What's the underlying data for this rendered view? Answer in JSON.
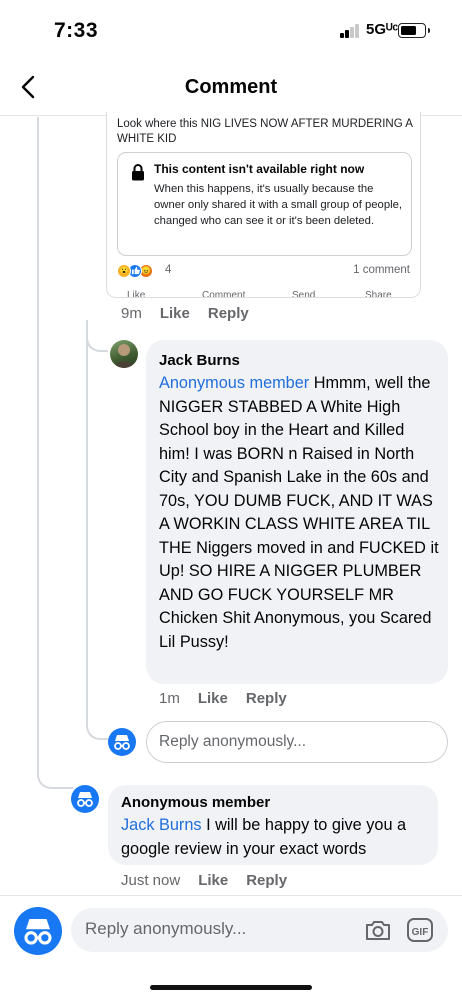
{
  "status_bar": {
    "time": "7:33",
    "network": "5Gᵁᶜ"
  },
  "header": {
    "title": "Comment",
    "back_icon": "chevron-left-icon"
  },
  "shared_post": {
    "text": "Look where this NIG LIVES NOW AFTER MURDERING A WHITE KID",
    "unavailable_title": "This content isn't available right now",
    "unavailable_body": "When this happens, it's usually because the owner only shared it with a small group of people, changed who can see it or it's been deleted.",
    "reaction_count": "4",
    "comment_count": "1 comment",
    "actions": [
      "Like",
      "Comment",
      "Send",
      "Share"
    ]
  },
  "root_comment_meta": {
    "time": "9m",
    "like": "Like",
    "reply": "Reply"
  },
  "reply_1": {
    "author": "Jack Burns",
    "mention": "Anonymous member",
    "text": " Hmmm, well the NIGGER STABBED A White High School boy in the Heart and Killed him! I was BORN n Raised in North City and Spanish Lake in the 60s and 70s, YOU DUMB FUCK, AND IT WAS A WORKIN CLASS WHITE AREA TIL THE Niggers moved in and FUCKED it Up! SO HIRE A NIGGER PLUMBER AND GO FUCK YOURSELF MR Chicken Shit Anonymous, you Scared Lil Pussy!",
    "time": "1m",
    "like": "Like",
    "reply": "Reply"
  },
  "reply_box": {
    "placeholder": "Reply anonymously..."
  },
  "reply_2": {
    "author": "Anonymous member",
    "mention": "Jack Burns",
    "text": " I will be happy to give you a google review in your exact words",
    "time": "Just now",
    "like": "Like",
    "reply": "Reply"
  },
  "composer": {
    "placeholder": "Reply anonymously..."
  },
  "colors": {
    "accent": "#1877f2",
    "mention": "#216fdb",
    "bubble": "#f0f2f5"
  }
}
